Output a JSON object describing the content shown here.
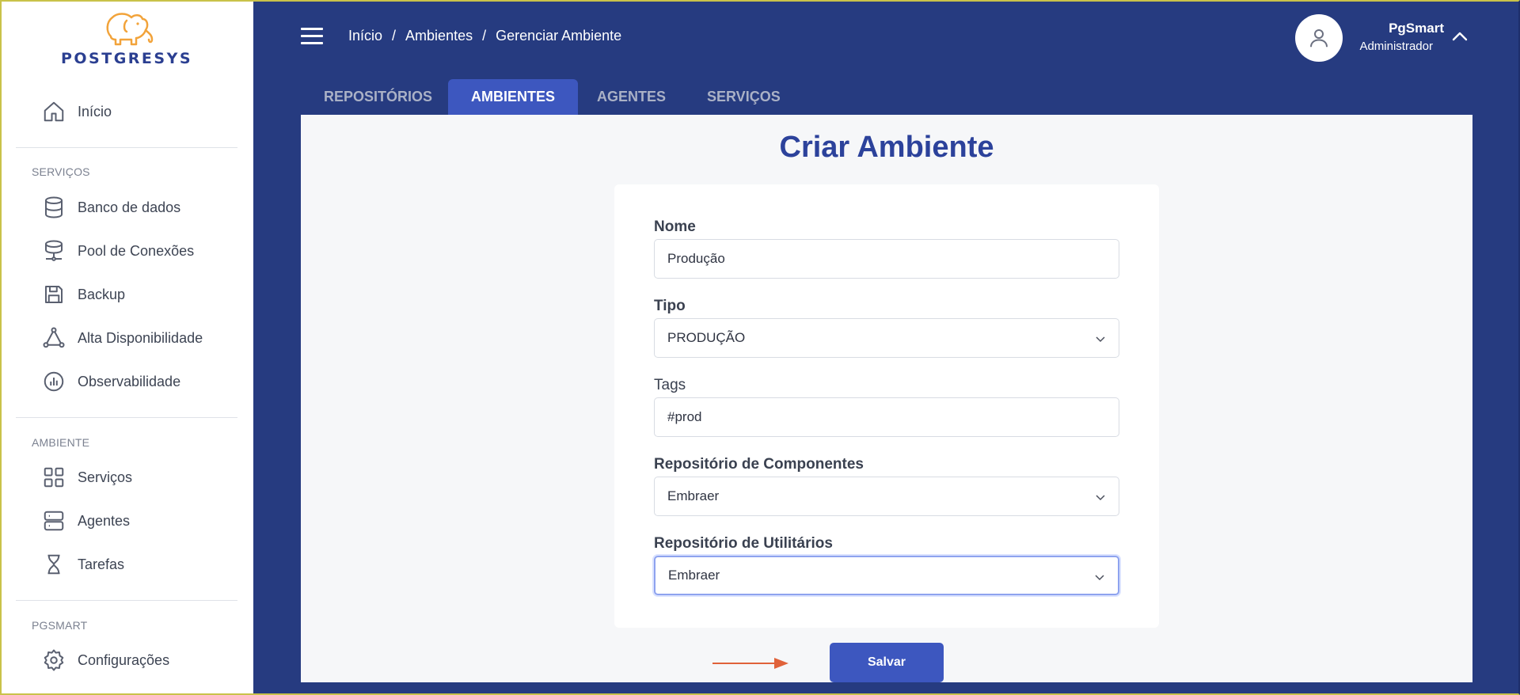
{
  "app": {
    "logo_text": "POSTGRESYS"
  },
  "sidebar": {
    "home": {
      "label": "Início",
      "icon": "home-icon"
    },
    "sections": [
      {
        "title": "SERVIÇOS",
        "items": [
          {
            "label": "Banco de dados",
            "icon": "database-icon"
          },
          {
            "label": "Pool de Conexões",
            "icon": "connection-pool-icon"
          },
          {
            "label": "Backup",
            "icon": "save-disk-icon"
          },
          {
            "label": "Alta Disponibilidade",
            "icon": "triangle-nodes-icon"
          },
          {
            "label": "Observabilidade",
            "icon": "bar-chart-circle-icon"
          }
        ]
      },
      {
        "title": "AMBIENTE",
        "items": [
          {
            "label": "Serviços",
            "icon": "grid-icon"
          },
          {
            "label": "Agentes",
            "icon": "server-icon"
          },
          {
            "label": "Tarefas",
            "icon": "hourglass-icon"
          }
        ]
      },
      {
        "title": "PGSMART",
        "items": [
          {
            "label": "Configurações",
            "icon": "gear-icon"
          }
        ]
      }
    ]
  },
  "header": {
    "breadcrumb": [
      "Início",
      "Ambientes",
      "Gerenciar Ambiente"
    ],
    "breadcrumb_separator": "/",
    "user": {
      "name": "PgSmart",
      "role": "Administrador"
    }
  },
  "tabs": [
    {
      "label": "REPOSITÓRIOS",
      "active": false
    },
    {
      "label": "AMBIENTES",
      "active": true
    },
    {
      "label": "AGENTES",
      "active": false
    },
    {
      "label": "SERVIÇOS",
      "active": false
    }
  ],
  "form": {
    "title": "Criar Ambiente",
    "fields": [
      {
        "label": "Nome",
        "value": "Produção",
        "type": "text"
      },
      {
        "label": "Tipo",
        "value": "PRODUÇÃO",
        "type": "select"
      },
      {
        "label": "Tags",
        "value": "#prod",
        "type": "text"
      },
      {
        "label": "Repositório de Componentes",
        "value": "Embraer",
        "type": "select"
      },
      {
        "label": "Repositório de Utilitários",
        "value": "Embraer",
        "type": "select",
        "focused": true
      }
    ],
    "save_label": "Salvar"
  },
  "colors": {
    "header_bg": "#263b80",
    "accent": "#3d57bf",
    "title": "#2c429b",
    "annotation_arrow": "#e0623a",
    "logo_orange": "#f2a33a"
  }
}
